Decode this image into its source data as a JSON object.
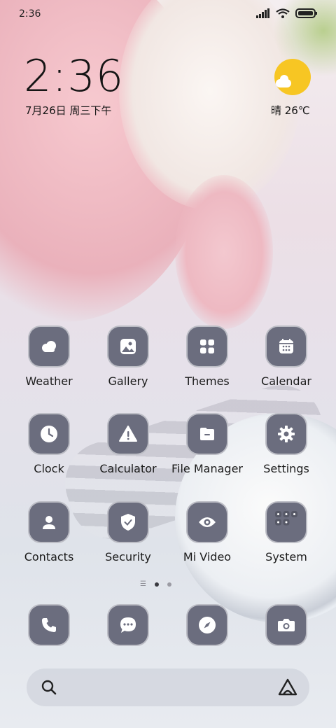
{
  "status_bar": {
    "time": "2:36"
  },
  "clock_widget": {
    "time": "2:36",
    "date": "7月26日 周三下午"
  },
  "weather_widget": {
    "text": "晴 26℃"
  },
  "apps": [
    {
      "label": "Weather",
      "icon": "weather-icon"
    },
    {
      "label": "Gallery",
      "icon": "gallery-icon"
    },
    {
      "label": "Themes",
      "icon": "themes-icon"
    },
    {
      "label": "Calendar",
      "icon": "calendar-icon"
    },
    {
      "label": "Clock",
      "icon": "clock-icon"
    },
    {
      "label": "Calculator",
      "icon": "warning-icon"
    },
    {
      "label": "File Manager",
      "icon": "file-manager-icon"
    },
    {
      "label": "Settings",
      "icon": "gear-icon"
    },
    {
      "label": "Contacts",
      "icon": "contacts-icon"
    },
    {
      "label": "Security",
      "icon": "shield-icon"
    },
    {
      "label": "Mi Video",
      "icon": "eye-icon"
    },
    {
      "label": "System",
      "icon": "folder-grid-icon"
    }
  ],
  "dock": [
    {
      "icon": "phone-icon"
    },
    {
      "icon": "message-icon"
    },
    {
      "icon": "compass-icon"
    },
    {
      "icon": "camera-icon"
    }
  ],
  "page_indicator": {
    "pages": 2,
    "active": 1
  },
  "colors": {
    "icon_bg": "#6b6d7e",
    "sun": "#f7c623"
  }
}
